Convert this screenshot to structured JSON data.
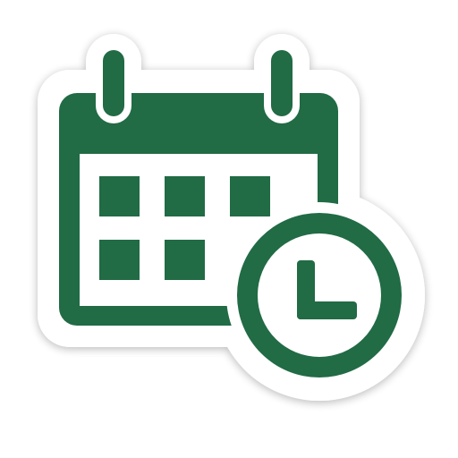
{
  "icon": {
    "name": "calendar-clock-icon",
    "primary_color": "#216b45",
    "outline_color": "#ffffff",
    "background_color": "#ffffff"
  }
}
